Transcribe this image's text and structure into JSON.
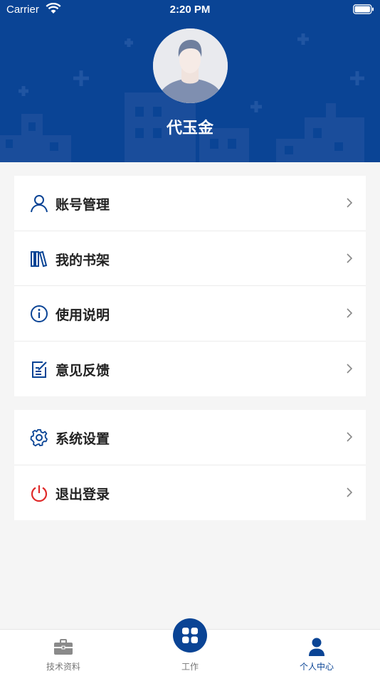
{
  "status_bar": {
    "carrier": "Carrier",
    "time": "2:20 PM"
  },
  "profile": {
    "name": "代玉金"
  },
  "menu_group_1": [
    {
      "label": "账号管理",
      "icon": "user-icon"
    },
    {
      "label": "我的书架",
      "icon": "bookshelf-icon"
    },
    {
      "label": "使用说明",
      "icon": "info-icon"
    },
    {
      "label": "意见反馈",
      "icon": "feedback-icon"
    }
  ],
  "menu_group_2": [
    {
      "label": "系统设置",
      "icon": "gear-icon"
    },
    {
      "label": "退出登录",
      "icon": "power-icon"
    }
  ],
  "tabbar": {
    "tabs": [
      {
        "label": "技术资料",
        "icon": "briefcase-icon",
        "active": false
      },
      {
        "label": "工作",
        "icon": "grid-icon",
        "active": false
      },
      {
        "label": "个人中心",
        "icon": "person-icon",
        "active": true
      }
    ]
  },
  "colors": {
    "brand": "#0a4495",
    "inactive": "#777777",
    "logout_red": "#e02b2b"
  }
}
